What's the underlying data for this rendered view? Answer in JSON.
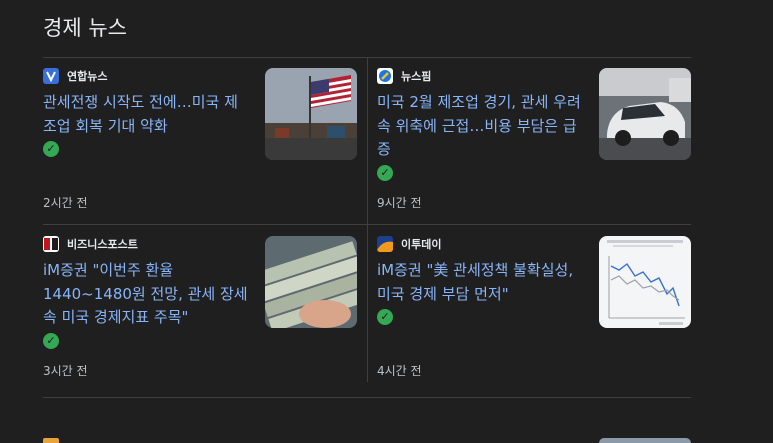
{
  "section_title": "경제 뉴스",
  "articles": [
    {
      "source": "연합뉴스",
      "logo_icon": "yonhap-logo-icon",
      "headline": "관세전쟁 시작도 전에…미국 제조업 회복 기대 약화",
      "verified_icon": "check-circle-icon",
      "time": "2시간 전",
      "thumbnail": "us-flag-port-image"
    },
    {
      "source": "뉴스핌",
      "logo_icon": "newspim-logo-icon",
      "headline": "미국 2월 제조업 경기, 관세 우려 속 위축에 근접…비용 부담은 급증",
      "verified_icon": "check-circle-icon",
      "time": "9시간 전",
      "thumbnail": "car-factory-image"
    },
    {
      "source": "비즈니스포스트",
      "logo_icon": "businesspost-logo-icon",
      "headline": "iM증권 \"이번주 환율 1440~1480원 전망, 관세 장세 속 미국 경제지표 주목\"",
      "verified_icon": "check-circle-icon",
      "time": "3시간 전",
      "thumbnail": "dollar-bills-image"
    },
    {
      "source": "이투데이",
      "logo_icon": "etoday-logo-icon",
      "headline": "iM증권 \"美 관세정책 불확실성, 미국 경제 부담 먼저\"",
      "verified_icon": "check-circle-icon",
      "time": "4시간 전",
      "thumbnail": "economic-chart-image"
    }
  ],
  "colors": {
    "background": "#1f1f1f",
    "headline": "#8ab4f8",
    "divider": "#3c4043",
    "verified": "#34a853"
  }
}
